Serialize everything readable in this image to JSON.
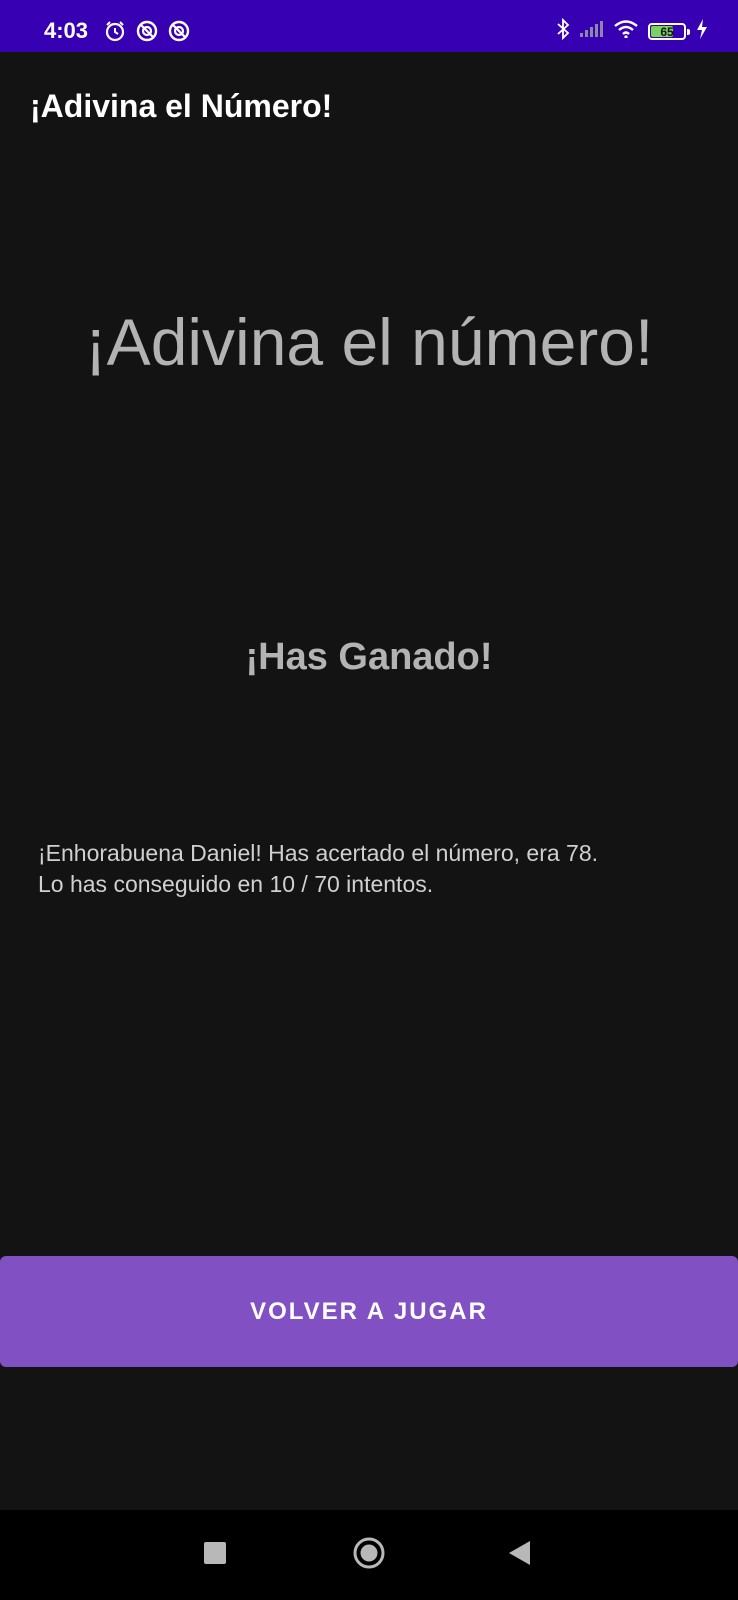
{
  "status_bar": {
    "time": "4:03",
    "left_icons": [
      "alarm-icon",
      "sync-blocked-icon",
      "sync-blocked-icon"
    ],
    "right_icons": [
      "bluetooth-icon",
      "signal-icon",
      "wifi-icon",
      "battery-icon",
      "charging-icon"
    ],
    "battery_level": "65",
    "background": "#3700b3"
  },
  "app_bar": {
    "title": "¡Adivina el Número!"
  },
  "main": {
    "heading": "¡Adivina el número!",
    "result_title": "¡Has Ganado!",
    "message_line1": "¡Enhorabuena Daniel! Has acertado el número, era 78.",
    "message_line2": "Lo has conseguido en 10 / 70 intentos.",
    "button_label": "VOLVER A JUGAR",
    "button_color": "#8150c2"
  },
  "nav_bar": {
    "buttons": [
      "recents-square-icon",
      "home-circle-icon",
      "back-triangle-icon"
    ]
  }
}
